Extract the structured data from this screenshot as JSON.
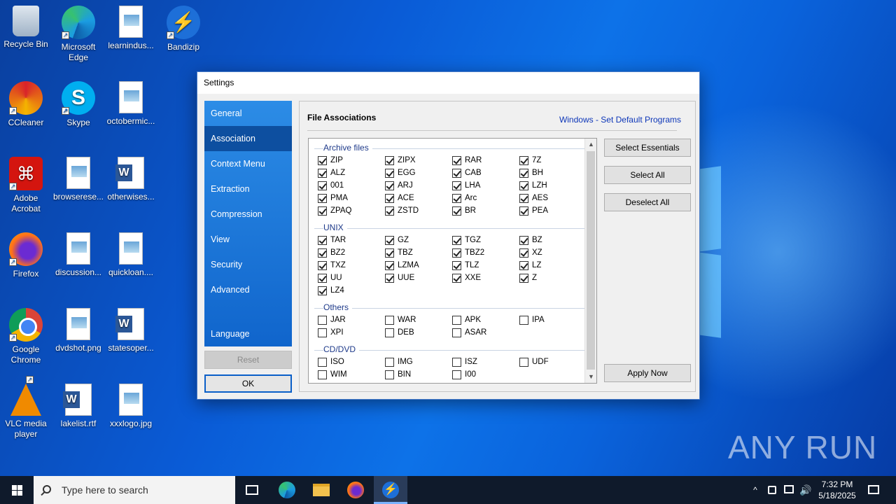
{
  "desktop": {
    "icons": [
      {
        "label": "Recycle Bin",
        "icon": "recycle-bin-icon"
      },
      {
        "label": "Microsoft Edge",
        "icon": "edge-icon"
      },
      {
        "label": "learnindus...",
        "icon": "image-file-icon"
      },
      {
        "label": "Bandizip",
        "icon": "bandizip-icon"
      },
      {
        "label": "CCleaner",
        "icon": "ccleaner-icon"
      },
      {
        "label": "Skype",
        "icon": "skype-icon"
      },
      {
        "label": "octobermic...",
        "icon": "image-file-icon"
      },
      {
        "label": "Adobe Acrobat",
        "icon": "acrobat-icon"
      },
      {
        "label": "browserese...",
        "icon": "image-file-icon"
      },
      {
        "label": "otherwises...",
        "icon": "word-doc-icon"
      },
      {
        "label": "Firefox",
        "icon": "firefox-icon"
      },
      {
        "label": "discussion...",
        "icon": "image-file-icon"
      },
      {
        "label": "quickloan....",
        "icon": "image-file-icon"
      },
      {
        "label": "Google Chrome",
        "icon": "chrome-icon"
      },
      {
        "label": "dvdshot.png",
        "icon": "image-file-icon"
      },
      {
        "label": "statesoper...",
        "icon": "word-doc-icon"
      },
      {
        "label": "VLC media player",
        "icon": "vlc-icon"
      },
      {
        "label": "lakelist.rtf",
        "icon": "word-doc-icon"
      },
      {
        "label": "xxxlogo.jpg",
        "icon": "image-file-icon"
      }
    ]
  },
  "settings": {
    "title": "Settings",
    "nav": [
      "General",
      "Association",
      "Context Menu",
      "Extraction",
      "Compression",
      "View",
      "Security",
      "Advanced"
    ],
    "nav_active": "Association",
    "language": "Language",
    "reset_label": "Reset",
    "ok_label": "OK",
    "panel_title": "File Associations",
    "default_programs_link": "Windows - Set Default Programs",
    "select_essentials": "Select Essentials",
    "select_all": "Select All",
    "deselect_all": "Deselect All",
    "apply_now": "Apply Now",
    "sections": [
      {
        "name": "Archive files",
        "items": [
          {
            "ext": "ZIP",
            "checked": true
          },
          {
            "ext": "ZIPX",
            "checked": true
          },
          {
            "ext": "RAR",
            "checked": true
          },
          {
            "ext": "7Z",
            "checked": true
          },
          {
            "ext": "ALZ",
            "checked": true
          },
          {
            "ext": "EGG",
            "checked": true
          },
          {
            "ext": "CAB",
            "checked": true
          },
          {
            "ext": "BH",
            "checked": true
          },
          {
            "ext": "001",
            "checked": true
          },
          {
            "ext": "ARJ",
            "checked": true
          },
          {
            "ext": "LHA",
            "checked": true
          },
          {
            "ext": "LZH",
            "checked": true
          },
          {
            "ext": "PMA",
            "checked": true
          },
          {
            "ext": "ACE",
            "checked": true
          },
          {
            "ext": "Arc",
            "checked": true
          },
          {
            "ext": "AES",
            "checked": true
          },
          {
            "ext": "ZPAQ",
            "checked": true
          },
          {
            "ext": "ZSTD",
            "checked": true
          },
          {
            "ext": "BR",
            "checked": true
          },
          {
            "ext": "PEA",
            "checked": true
          }
        ]
      },
      {
        "name": "UNIX",
        "items": [
          {
            "ext": "TAR",
            "checked": true
          },
          {
            "ext": "GZ",
            "checked": true
          },
          {
            "ext": "TGZ",
            "checked": true
          },
          {
            "ext": "BZ",
            "checked": true
          },
          {
            "ext": "BZ2",
            "checked": true
          },
          {
            "ext": "TBZ",
            "checked": true
          },
          {
            "ext": "TBZ2",
            "checked": true
          },
          {
            "ext": "XZ",
            "checked": true
          },
          {
            "ext": "TXZ",
            "checked": true
          },
          {
            "ext": "LZMA",
            "checked": true
          },
          {
            "ext": "TLZ",
            "checked": true
          },
          {
            "ext": "LZ",
            "checked": true
          },
          {
            "ext": "UU",
            "checked": true
          },
          {
            "ext": "UUE",
            "checked": true
          },
          {
            "ext": "XXE",
            "checked": true
          },
          {
            "ext": "Z",
            "checked": true
          },
          {
            "ext": "LZ4",
            "checked": true
          }
        ]
      },
      {
        "name": "Others",
        "items": [
          {
            "ext": "JAR",
            "checked": false
          },
          {
            "ext": "WAR",
            "checked": false
          },
          {
            "ext": "APK",
            "checked": false
          },
          {
            "ext": "IPA",
            "checked": false
          },
          {
            "ext": "XPI",
            "checked": false
          },
          {
            "ext": "DEB",
            "checked": false
          },
          {
            "ext": "ASAR",
            "checked": false
          }
        ]
      },
      {
        "name": "CD/DVD",
        "items": [
          {
            "ext": "ISO",
            "checked": false
          },
          {
            "ext": "IMG",
            "checked": false
          },
          {
            "ext": "ISZ",
            "checked": false
          },
          {
            "ext": "UDF",
            "checked": false
          },
          {
            "ext": "WIM",
            "checked": false
          },
          {
            "ext": "BIN",
            "checked": false
          },
          {
            "ext": "I00",
            "checked": false
          }
        ]
      }
    ]
  },
  "taskbar": {
    "search_placeholder": "Type here to search",
    "time": "7:32 PM",
    "date": "5/18/2025"
  },
  "watermark": "ANY RUN"
}
